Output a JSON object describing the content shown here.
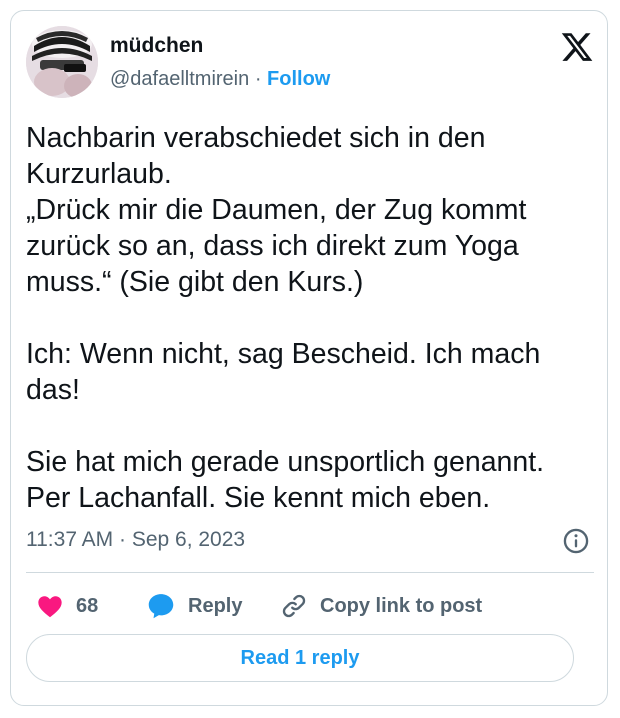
{
  "author": {
    "display_name": "müdchen",
    "handle": "@dafaelltmirein",
    "separator": "·",
    "follow_label": "Follow"
  },
  "tweet": {
    "text": "Nachbarin verabschiedet sich in den\nKurzurlaub.\n„Drück mir die Daumen, der Zug kommt\nzurück so an, dass ich direkt zum Yoga\nmuss.“ (Sie gibt den Kurs.)\n\nIch: Wenn nicht, sag Bescheid. Ich mach\ndas!\n\nSie hat mich gerade unsportlich genannt.\nPer Lachanfall. Sie kennt mich eben.",
    "timestamp": "11:37 AM · Sep 6, 2023"
  },
  "actions": {
    "like_count": "68",
    "reply_label": "Reply",
    "copy_link_label": "Copy link to post"
  },
  "read_reply_label": "Read 1 reply",
  "icons": {
    "brand": "x-logo-icon",
    "info": "info-icon",
    "like": "heart-icon",
    "reply": "speech-bubble-icon",
    "copy": "link-icon"
  },
  "colors": {
    "accent": "#1d9bf0",
    "like": "#f91880",
    "text": "#0f1419",
    "secondary": "#536471",
    "border": "#cfd9de"
  }
}
